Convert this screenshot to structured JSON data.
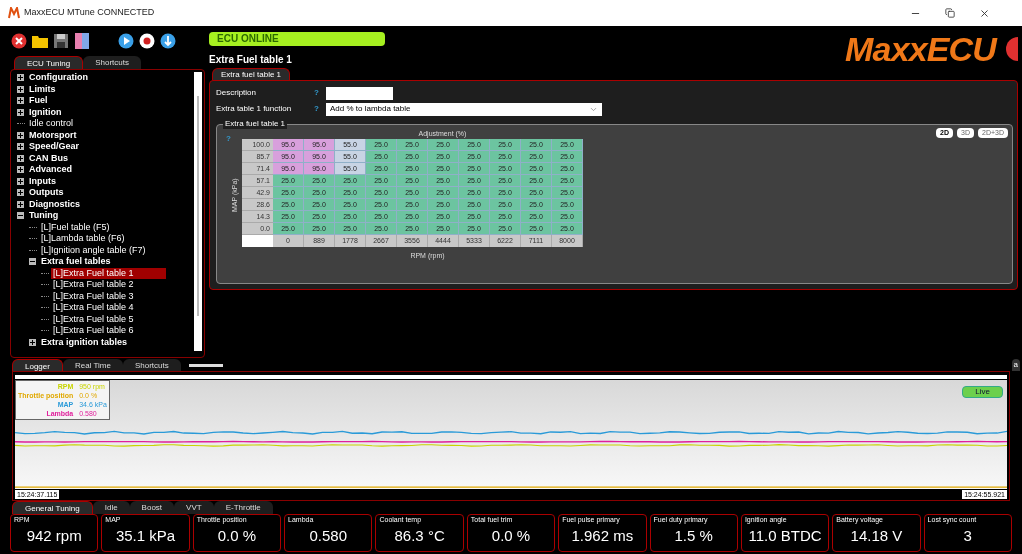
{
  "window": {
    "title": "MaxxECU MTune CONNECTED"
  },
  "status": {
    "text": "ECU ONLINE",
    "online": true
  },
  "page_title": "Extra Fuel table 1",
  "logo": "MaxxECU",
  "left_tabs": [
    {
      "label": "ECU Tuning",
      "selected": true
    },
    {
      "label": "Shortcuts",
      "selected": false
    }
  ],
  "tree": [
    {
      "label": "Configuration",
      "expanded": false,
      "selected": false
    },
    {
      "label": "Limits",
      "expanded": false,
      "selected": false
    },
    {
      "label": "Fuel",
      "expanded": false,
      "selected": false
    },
    {
      "label": "Ignition",
      "expanded": false,
      "selected": false
    },
    {
      "label": "Idle control",
      "selected": false
    },
    {
      "label": "Motorsport",
      "expanded": false,
      "selected": false
    },
    {
      "label": "Speed/Gear",
      "expanded": false,
      "selected": false
    },
    {
      "label": "CAN Bus",
      "expanded": false,
      "selected": false
    },
    {
      "label": "Advanced",
      "expanded": false,
      "selected": false
    },
    {
      "label": "Inputs",
      "expanded": false,
      "selected": false
    },
    {
      "label": "Outputs",
      "expanded": false,
      "selected": false
    },
    {
      "label": "Diagnostics",
      "expanded": false,
      "selected": false
    },
    {
      "label": "Tuning",
      "expanded": true,
      "selected": false,
      "children": [
        {
          "label": "[L]Fuel table (F5)",
          "selected": false
        },
        {
          "label": "[L]Lambda table (F6)",
          "selected": false
        },
        {
          "label": "[L]Ignition angle table (F7)",
          "selected": false
        },
        {
          "label": "Extra fuel tables",
          "expanded": true,
          "selected": false,
          "children": [
            {
              "label": "[L]Extra Fuel table 1",
              "selected": true
            },
            {
              "label": "[L]Extra Fuel table 2",
              "selected": false
            },
            {
              "label": "[L]Extra Fuel table 3",
              "selected": false
            },
            {
              "label": "[L]Extra Fuel table 4",
              "selected": false
            },
            {
              "label": "[L]Extra Fuel table 5",
              "selected": false
            },
            {
              "label": "[L]Extra Fuel table 6",
              "selected": false
            }
          ]
        },
        {
          "label": "Extra ignition tables",
          "expanded": false,
          "selected": false
        }
      ]
    }
  ],
  "editor": {
    "tab": "Extra fuel table 1",
    "fields": [
      {
        "label": "Description",
        "help": "?",
        "kind": "text"
      },
      {
        "label": "Extra table 1 function",
        "help": "?",
        "value": "Add % to lambda table",
        "kind": "select"
      }
    ],
    "group_title": "Extra fuel table 1",
    "help": "?",
    "view_buttons": [
      {
        "label": "2D",
        "selected": true
      },
      {
        "label": "3D",
        "selected": false
      },
      {
        "label": "2D+3D",
        "selected": false
      }
    ],
    "table": {
      "title": "Adjustment (%)",
      "ylabel": "MAP (kPa)",
      "xlabel": "RPM (rpm)",
      "rows": [
        {
          "label": "100.0",
          "cells": [
            {
              "value": "95.0",
              "color": "#d8a0dc"
            },
            {
              "value": "95.0",
              "color": "#d8a0dc"
            },
            {
              "value": "55.0",
              "color": "#c8d4e4"
            },
            {
              "value": "25.0",
              "color": "#6cc4a0"
            },
            {
              "value": "25.0",
              "color": "#6cc4a0"
            },
            {
              "value": "25.0",
              "color": "#6cc4a0"
            },
            {
              "value": "25.0",
              "color": "#6cc4a0"
            },
            {
              "value": "25.0",
              "color": "#6cc4a0"
            },
            {
              "value": "25.0",
              "color": "#6cc4a0"
            },
            {
              "value": "25.0",
              "color": "#6cc4a0"
            }
          ]
        },
        {
          "label": "85.7",
          "cells": [
            {
              "value": "95.0",
              "color": "#d8a0dc"
            },
            {
              "value": "95.0",
              "color": "#d8a0dc"
            },
            {
              "value": "55.0",
              "color": "#c8d4e4"
            },
            {
              "value": "25.0",
              "color": "#6cc4a0"
            },
            {
              "value": "25.0",
              "color": "#6cc4a0"
            },
            {
              "value": "25.0",
              "color": "#6cc4a0"
            },
            {
              "value": "25.0",
              "color": "#6cc4a0"
            },
            {
              "value": "25.0",
              "color": "#6cc4a0"
            },
            {
              "value": "25.0",
              "color": "#6cc4a0"
            },
            {
              "value": "25.0",
              "color": "#6cc4a0"
            }
          ]
        },
        {
          "label": "71.4",
          "cells": [
            {
              "value": "95.0",
              "color": "#d8a0dc"
            },
            {
              "value": "95.0",
              "color": "#d8a0dc"
            },
            {
              "value": "55.0",
              "color": "#c8d4e4"
            },
            {
              "value": "25.0",
              "color": "#6cc4a0"
            },
            {
              "value": "25.0",
              "color": "#6cc4a0"
            },
            {
              "value": "25.0",
              "color": "#6cc4a0"
            },
            {
              "value": "25.0",
              "color": "#6cc4a0"
            },
            {
              "value": "25.0",
              "color": "#6cc4a0"
            },
            {
              "value": "25.0",
              "color": "#6cc4a0"
            },
            {
              "value": "25.0",
              "color": "#6cc4a0"
            }
          ]
        },
        {
          "label": "57.1",
          "cells": [
            {
              "value": "25.0",
              "color": "#6cc4a0"
            },
            {
              "value": "25.0",
              "color": "#6cc4a0"
            },
            {
              "value": "25.0",
              "color": "#6cc4a0"
            },
            {
              "value": "25.0",
              "color": "#6cc4a0"
            },
            {
              "value": "25.0",
              "color": "#6cc4a0"
            },
            {
              "value": "25.0",
              "color": "#6cc4a0"
            },
            {
              "value": "25.0",
              "color": "#6cc4a0"
            },
            {
              "value": "25.0",
              "color": "#6cc4a0"
            },
            {
              "value": "25.0",
              "color": "#6cc4a0"
            },
            {
              "value": "25.0",
              "color": "#6cc4a0"
            }
          ]
        },
        {
          "label": "42.9",
          "cells": [
            {
              "value": "25.0",
              "color": "#6cc4a0"
            },
            {
              "value": "25.0",
              "color": "#6cc4a0"
            },
            {
              "value": "25.0",
              "color": "#6cc4a0"
            },
            {
              "value": "25.0",
              "color": "#6cc4a0"
            },
            {
              "value": "25.0",
              "color": "#6cc4a0"
            },
            {
              "value": "25.0",
              "color": "#6cc4a0"
            },
            {
              "value": "25.0",
              "color": "#6cc4a0"
            },
            {
              "value": "25.0",
              "color": "#6cc4a0"
            },
            {
              "value": "25.0",
              "color": "#6cc4a0"
            },
            {
              "value": "25.0",
              "color": "#6cc4a0"
            }
          ]
        },
        {
          "label": "28.6",
          "cells": [
            {
              "value": "25.0",
              "color": "#6cc4a0"
            },
            {
              "value": "25.0",
              "color": "#6cc4a0"
            },
            {
              "value": "25.0",
              "color": "#6cc4a0"
            },
            {
              "value": "25.0",
              "color": "#6cc4a0"
            },
            {
              "value": "25.0",
              "color": "#6cc4a0"
            },
            {
              "value": "25.0",
              "color": "#6cc4a0"
            },
            {
              "value": "25.0",
              "color": "#6cc4a0"
            },
            {
              "value": "25.0",
              "color": "#6cc4a0"
            },
            {
              "value": "25.0",
              "color": "#6cc4a0"
            },
            {
              "value": "25.0",
              "color": "#6cc4a0"
            }
          ]
        },
        {
          "label": "14.3",
          "cells": [
            {
              "value": "25.0",
              "color": "#6cc4a0"
            },
            {
              "value": "25.0",
              "color": "#6cc4a0"
            },
            {
              "value": "25.0",
              "color": "#6cc4a0"
            },
            {
              "value": "25.0",
              "color": "#6cc4a0"
            },
            {
              "value": "25.0",
              "color": "#6cc4a0"
            },
            {
              "value": "25.0",
              "color": "#6cc4a0"
            },
            {
              "value": "25.0",
              "color": "#6cc4a0"
            },
            {
              "value": "25.0",
              "color": "#6cc4a0"
            },
            {
              "value": "25.0",
              "color": "#6cc4a0"
            },
            {
              "value": "25.0",
              "color": "#6cc4a0"
            }
          ]
        },
        {
          "label": "0.0",
          "cells": [
            {
              "value": "25.0",
              "color": "#6cc4a0"
            },
            {
              "value": "25.0",
              "color": "#6cc4a0"
            },
            {
              "value": "25.0",
              "color": "#6cc4a0"
            },
            {
              "value": "25.0",
              "color": "#6cc4a0"
            },
            {
              "value": "25.0",
              "color": "#6cc4a0"
            },
            {
              "value": "25.0",
              "color": "#6cc4a0"
            },
            {
              "value": "25.0",
              "color": "#6cc4a0"
            },
            {
              "value": "25.0",
              "color": "#6cc4a0"
            },
            {
              "value": "25.0",
              "color": "#6cc4a0"
            },
            {
              "value": "25.0",
              "color": "#6cc4a0"
            }
          ]
        }
      ],
      "rpm_axis": [
        "0",
        "889",
        "1778",
        "2667",
        "3556",
        "4444",
        "5333",
        "6222",
        "7111",
        "8000"
      ]
    }
  },
  "logger_tabs": [
    {
      "label": "Logger",
      "selected": true
    },
    {
      "label": "Real Time",
      "selected": false
    },
    {
      "label": "Shortcuts",
      "selected": false
    }
  ],
  "side_tab": "a",
  "logger": {
    "live": "Live",
    "start_time": "15:24:37.115",
    "end_time": "15:24:55.921",
    "legend": [
      {
        "name": "RPM",
        "value": "950 rpm",
        "color": "#c8d400"
      },
      {
        "name": "Throttle position",
        "value": "0.0 %",
        "color": "#e0a800"
      },
      {
        "name": "MAP",
        "value": "34.6 kPa",
        "color": "#2a9ad8"
      },
      {
        "name": "Lambda",
        "value": "0.580",
        "color": "#e0209c"
      }
    ]
  },
  "bottom_tabs": [
    {
      "label": "General Tuning",
      "selected": true
    },
    {
      "label": "Idle",
      "selected": false
    },
    {
      "label": "Boost",
      "selected": false
    },
    {
      "label": "VVT",
      "selected": false
    },
    {
      "label": "E-Throttle",
      "selected": false
    }
  ],
  "gauges": [
    {
      "label": "RPM",
      "value": "942 rpm"
    },
    {
      "label": "MAP",
      "value": "35.1 kPa"
    },
    {
      "label": "Throttle position",
      "value": "0.0 %"
    },
    {
      "label": "Lambda",
      "value": "0.580"
    },
    {
      "label": "Coolant temp",
      "value": "86.3 °C"
    },
    {
      "label": "Total fuel trim",
      "value": "0.0 %"
    },
    {
      "label": "Fuel pulse primary",
      "value": "1.962 ms"
    },
    {
      "label": "Fuel duty primary",
      "value": "1.5 %"
    },
    {
      "label": "Ignition angle",
      "value": "11.0 BTDC"
    },
    {
      "label": "Battery voltage",
      "value": "14.18 V"
    },
    {
      "label": "Lost sync count",
      "value": "3"
    }
  ]
}
